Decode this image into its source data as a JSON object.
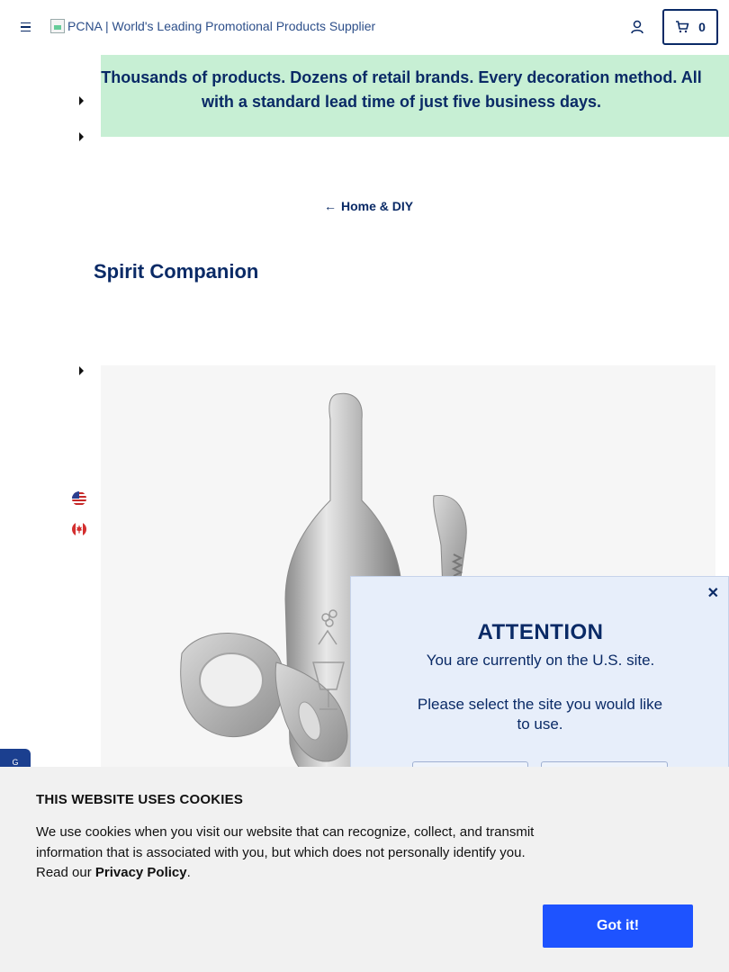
{
  "header": {
    "logo_alt": "PCNA | World's Leading Promotional Products Supplier",
    "cart_count": "0"
  },
  "banner": {
    "line1": "Thousands of products. Dozens of retail brands. Every decoration method. All",
    "line2": "with a standard lead time of just five business days."
  },
  "breadcrumb": {
    "back_label": "Home & DIY",
    "arrow": "←"
  },
  "product": {
    "title": "Spirit Companion"
  },
  "feedback_tab": {
    "label": "G"
  },
  "modal": {
    "close_glyph": "✕",
    "title": "ATTENTION",
    "subtitle": "You are currently on the U.S. site.",
    "prompt": "Please select the site you would like to use."
  },
  "cookie": {
    "title": "THIS WEBSITE USES COOKIES",
    "body": "We use cookies when you visit our website that can recognize, collect, and transmit information that is associated with you, but which does not personally identify you. Read our ",
    "link": "Privacy Policy",
    "tail": ".",
    "button": "Got it!"
  },
  "colors": {
    "brand_navy": "#0a2a66",
    "banner_green": "#c7efd4",
    "cookie_button": "#1e53ff",
    "modal_bg": "#e7eefa"
  }
}
